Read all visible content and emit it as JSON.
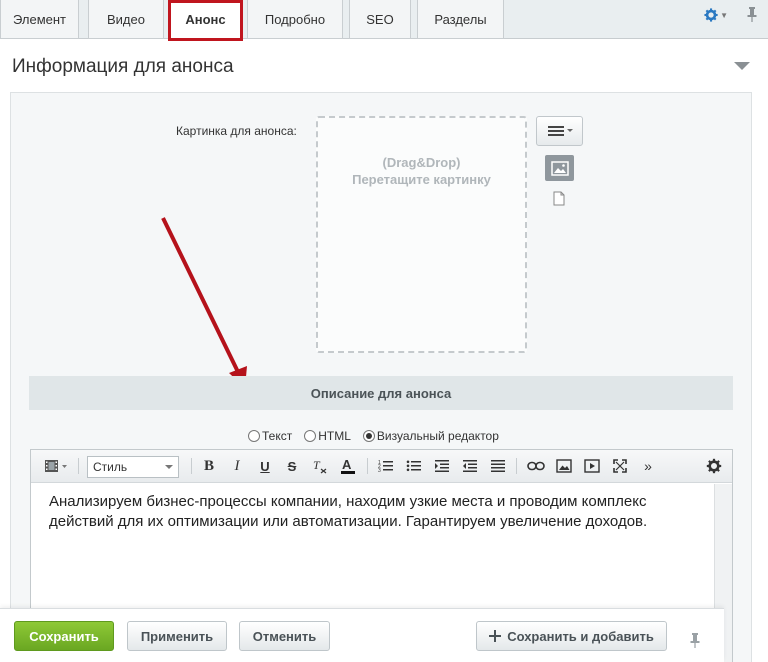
{
  "tabs": [
    {
      "label": "Элемент",
      "active": false
    },
    {
      "label": "Видео",
      "active": false
    },
    {
      "label": "Анонс",
      "active": true
    },
    {
      "label": "Подробно",
      "active": false
    },
    {
      "label": "SEO",
      "active": false
    },
    {
      "label": "Разделы",
      "active": false
    }
  ],
  "tab_icons": {
    "settings": "gear-icon",
    "pin": "pin-icon"
  },
  "section": {
    "title": "Информация для анонса"
  },
  "picture": {
    "label": "Картинка для анонса:",
    "drop_line1": "(Drag&Drop)",
    "drop_line2": "Перетащите картинку"
  },
  "description": {
    "title": "Описание для анонса",
    "modes": [
      {
        "label": "Текст",
        "selected": false
      },
      {
        "label": "HTML",
        "selected": false
      },
      {
        "label": "Визуальный редактор",
        "selected": true
      }
    ]
  },
  "editor": {
    "style_value": "Стиль",
    "content": "Анализируем бизнес-процессы компании, находим узкие места и проводим комплекс действий для их оптимизации или автоматизации. Гарантируем увеличение доходов."
  },
  "footer": {
    "save": "Сохранить",
    "apply": "Применить",
    "cancel": "Отменить",
    "save_add": "Сохранить и добавить"
  },
  "colors": {
    "accent": "#c0151e",
    "primary_button": "#7bb82c",
    "link_blue": "#2b79c2"
  }
}
